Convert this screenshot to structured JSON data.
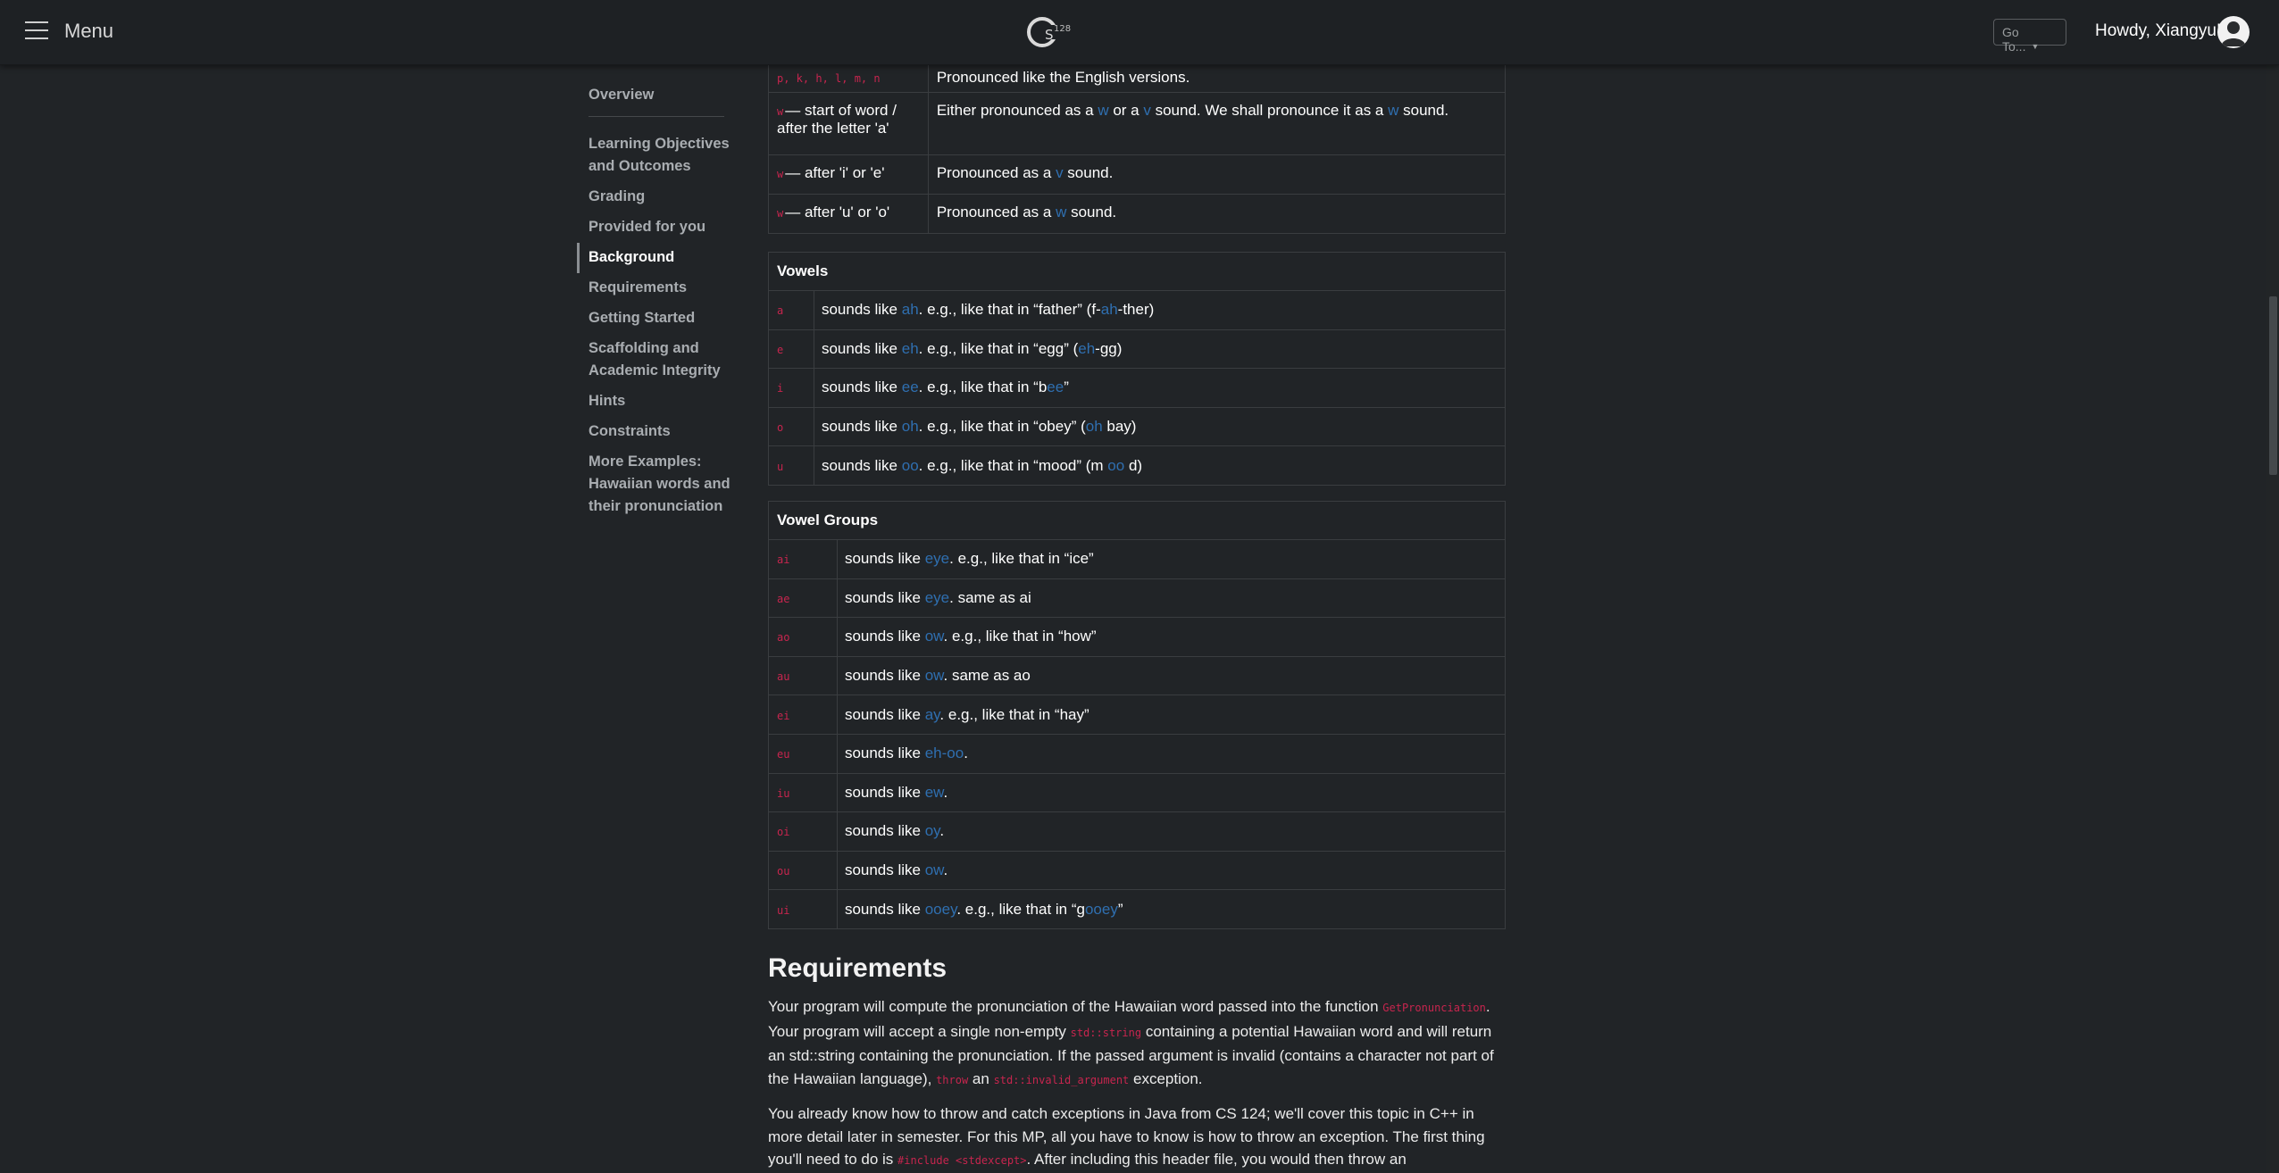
{
  "topbar": {
    "menu_label": "Menu",
    "logo_text": "CS128",
    "goto_label": "Go To...",
    "greeting": "Howdy, Xiangyu!"
  },
  "sidebar": {
    "items": [
      {
        "label": "Overview",
        "active": false
      },
      {
        "label": "Learning Objectives and Outcomes",
        "active": false
      },
      {
        "label": "Grading",
        "active": false
      },
      {
        "label": "Provided for you",
        "active": false
      },
      {
        "label": "Background",
        "active": true
      },
      {
        "label": "Requirements",
        "active": false
      },
      {
        "label": "Getting Started",
        "active": false
      },
      {
        "label": "Scaffolding and Academic Integrity",
        "active": false
      },
      {
        "label": "Hints",
        "active": false
      },
      {
        "label": "Constraints",
        "active": false
      },
      {
        "label": "More Examples: Hawaiian words and their pronunciation",
        "active": false
      }
    ]
  },
  "consonants": {
    "rows": [
      {
        "code": "p, k, h, l, m, n",
        "label": "",
        "desc": "Pronounced like the English versions."
      },
      {
        "code": "w",
        "label": "— start of word / after the letter 'a'",
        "desc_parts": [
          "Either pronounced as a ",
          "w",
          " or a ",
          "v",
          " sound. We shall pronounce it as a ",
          "w",
          " sound."
        ]
      },
      {
        "code": "w",
        "label": "— after 'i' or 'e'",
        "desc_parts": [
          "Pronounced as a ",
          "v",
          " sound."
        ]
      },
      {
        "code": "w",
        "label": "— after 'u' or 'o'",
        "desc_parts": [
          "Pronounced as a ",
          "w",
          " sound."
        ]
      }
    ]
  },
  "vowels": {
    "header": "Vowels",
    "rows": [
      {
        "code": "a",
        "parts": [
          "sounds like ",
          "ah",
          ". e.g., like that in “father” (f-",
          "ah",
          "-ther)"
        ]
      },
      {
        "code": "e",
        "parts": [
          "sounds like ",
          "eh",
          ". e.g., like that in “egg” (",
          "eh",
          "-gg)"
        ]
      },
      {
        "code": "i",
        "parts": [
          "sounds like ",
          "ee",
          ". e.g., like that in “b",
          "ee",
          "”"
        ]
      },
      {
        "code": "o",
        "parts": [
          "sounds like ",
          "oh",
          ". e.g., like that in “obey” (",
          "oh",
          " bay)"
        ]
      },
      {
        "code": "u",
        "parts": [
          "sounds like ",
          "oo",
          ". e.g., like that in “mood” (m ",
          "oo",
          " d)"
        ]
      }
    ]
  },
  "vowel_groups": {
    "header": "Vowel Groups",
    "rows": [
      {
        "code": "ai",
        "parts": [
          "sounds like ",
          "eye",
          ". e.g., like that in “ice”"
        ]
      },
      {
        "code": "ae",
        "parts": [
          "sounds like ",
          "eye",
          ". same as ai"
        ]
      },
      {
        "code": "ao",
        "parts": [
          "sounds like ",
          "ow",
          ". e.g., like that in “how”"
        ]
      },
      {
        "code": "au",
        "parts": [
          "sounds like ",
          "ow",
          ". same as ao"
        ]
      },
      {
        "code": "ei",
        "parts": [
          "sounds like ",
          "ay",
          ". e.g., like that in “hay”"
        ]
      },
      {
        "code": "eu",
        "parts": [
          "sounds like ",
          "eh-oo",
          "."
        ]
      },
      {
        "code": "iu",
        "parts": [
          "sounds like ",
          "ew",
          "."
        ]
      },
      {
        "code": "oi",
        "parts": [
          "sounds like ",
          "oy",
          "."
        ]
      },
      {
        "code": "ou",
        "parts": [
          "sounds like ",
          "ow",
          "."
        ]
      },
      {
        "code": "ui",
        "parts": [
          "sounds like ",
          "ooey",
          ". e.g., like that in “g",
          "ooey",
          "”"
        ]
      }
    ]
  },
  "requirements": {
    "title": "Requirements",
    "p1": {
      "t1": "Your program will compute the pronunciation of the Hawaiian word passed into the function ",
      "c1": "GetPronunciation",
      "t2": ". Your program will accept a single non-empty ",
      "c2": "std::string",
      "t3": " containing a potential Hawaiian word and will return an std::string containing the pronunciation. If the passed argument is invalid (contains a character not part of the Hawaiian language), ",
      "c3": "throw",
      "t4": " an ",
      "c4": "std::invalid_argument",
      "t5": " exception."
    },
    "p2": {
      "t1": "You already know how to throw and catch exceptions in Java from CS 124; we'll cover this topic in C++ in more detail later in semester. For this MP, all you have to know is how to throw an exception. The first thing you'll need to do is ",
      "c1": "#include <stdexcept>",
      "t2": ". After including this header file, you would then throw an"
    }
  },
  "colors": {
    "background": "#212427",
    "code_red": "#c7254e",
    "link_blue": "#2f6fb0"
  }
}
